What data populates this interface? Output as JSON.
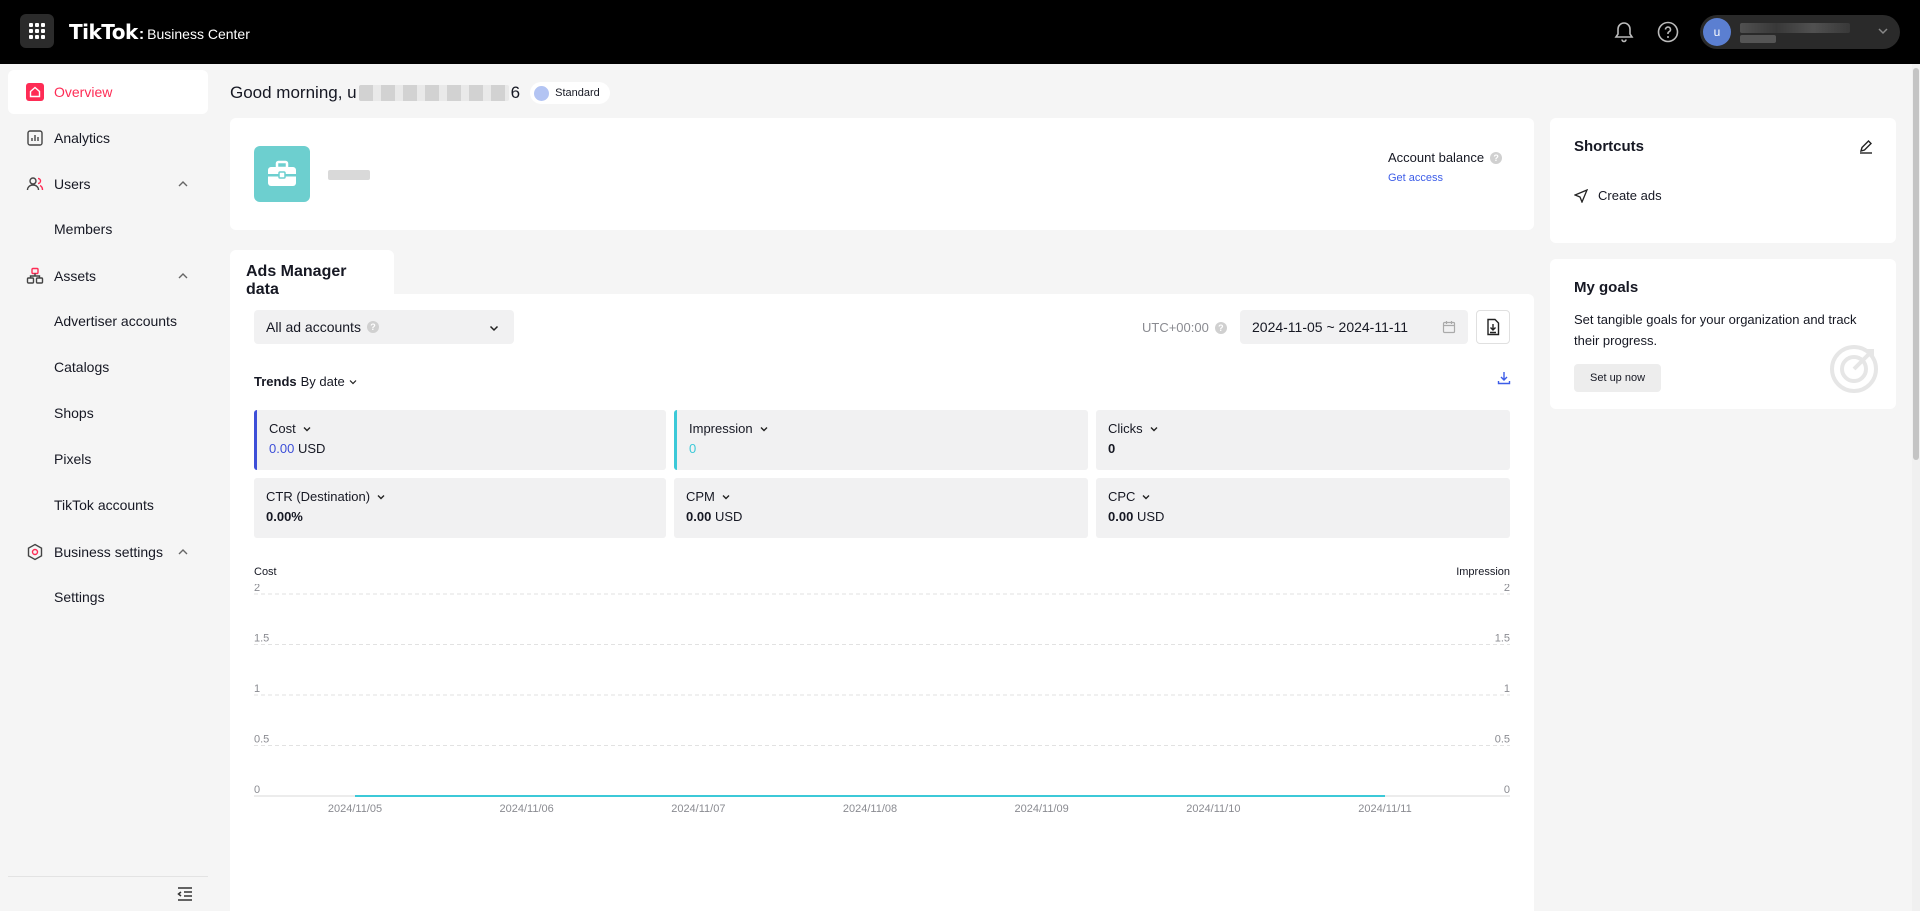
{
  "topbar": {
    "brand": "TikTok",
    "brand_separator": ":",
    "product": "Business Center",
    "user_initial": "u"
  },
  "sidebar": {
    "items": [
      {
        "label": "Overview",
        "icon": "home-icon",
        "active": true
      },
      {
        "label": "Analytics",
        "icon": "analytics-icon"
      },
      {
        "label": "Users",
        "icon": "users-icon",
        "expanded": true
      },
      {
        "label": "Members"
      },
      {
        "label": "Assets",
        "icon": "assets-icon",
        "expanded": true
      },
      {
        "label": "Advertiser accounts"
      },
      {
        "label": "Catalogs"
      },
      {
        "label": "Shops"
      },
      {
        "label": "Pixels"
      },
      {
        "label": "TikTok accounts"
      },
      {
        "label": "Business settings",
        "icon": "settings-icon",
        "expanded": true
      },
      {
        "label": "Settings"
      }
    ]
  },
  "greeting": {
    "prefix": "Good morning, u",
    "suffix": "6",
    "badge": "Standard"
  },
  "business": {
    "balance_label": "Account balance",
    "get_access": "Get access"
  },
  "shortcuts": {
    "title": "Shortcuts",
    "items": [
      {
        "label": "Create ads",
        "icon": "send-icon"
      }
    ]
  },
  "goals": {
    "title": "My goals",
    "description": "Set tangible goals for your organization and track their progress.",
    "button": "Set up now"
  },
  "ads": {
    "tab": "Ads Manager data",
    "account_select": "All ad accounts",
    "timezone": "UTC+00:00",
    "date_range": "2024-11-05 ~ 2024-11-11",
    "trends_label": "Trends",
    "trends_mode": "By date",
    "metrics": [
      {
        "label": "CTR (Destination)",
        "value": "0.00%",
        "unit": ""
      },
      {
        "label": "CPM",
        "value": "0.00",
        "unit": "USD"
      },
      {
        "label": "CPC",
        "value": "0.00",
        "unit": "USD"
      }
    ],
    "metric_cost": {
      "label": "Cost",
      "value": "0.00",
      "unit": "USD"
    },
    "metric_impression": {
      "label": "Impression",
      "value": "0"
    },
    "metric_clicks": {
      "label": "Clicks",
      "value": "0"
    }
  },
  "colors": {
    "accent": "#fe2c55",
    "cost_series": "#3d4fd8",
    "impression_series": "#3cc9d8"
  },
  "chart_data": {
    "type": "line",
    "x": [
      "2024/11/05",
      "2024/11/06",
      "2024/11/07",
      "2024/11/08",
      "2024/11/09",
      "2024/11/10",
      "2024/11/11"
    ],
    "series": [
      {
        "name": "Cost",
        "axis": "left",
        "values": [
          0,
          0,
          0,
          0,
          0,
          0,
          0
        ]
      },
      {
        "name": "Impression",
        "axis": "right",
        "values": [
          0,
          0,
          0,
          0,
          0,
          0,
          0
        ]
      }
    ],
    "ylabel_left": "Cost",
    "ylabel_right": "Impression",
    "ylim": [
      0,
      2
    ],
    "yticks": [
      "0",
      "0.5",
      "1",
      "1.5",
      "2"
    ],
    "grid": true
  }
}
